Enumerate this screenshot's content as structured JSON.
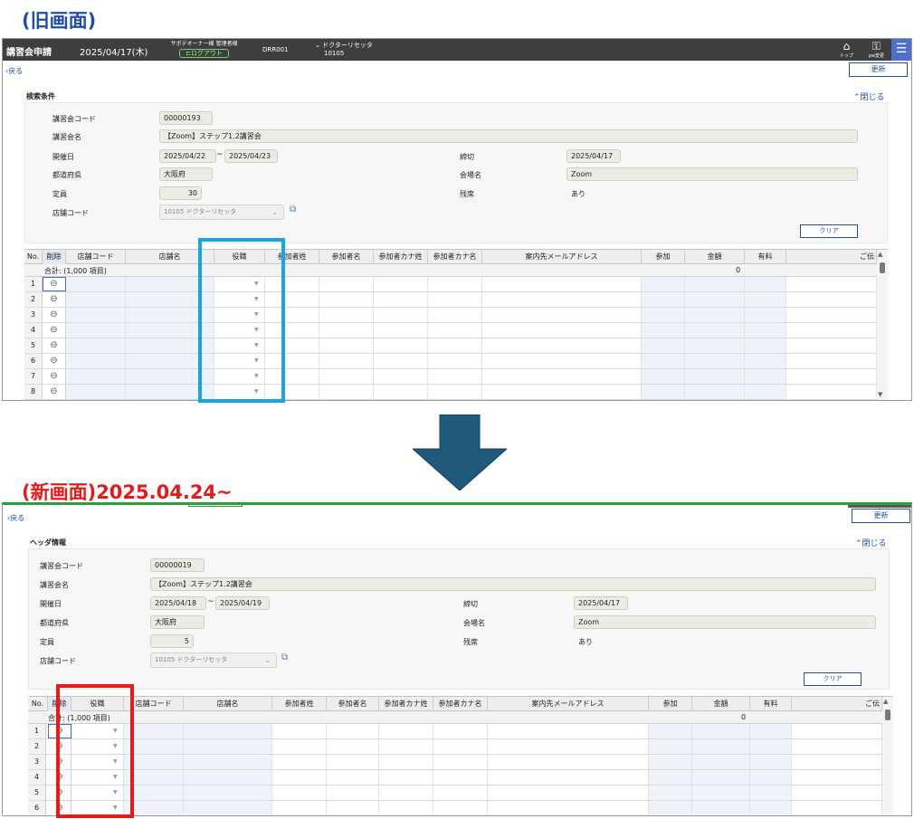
{
  "captions": {
    "old": "(旧画面)",
    "new": "(新画面)2025.04.24~"
  },
  "colors": {
    "highlight_old": "#16a4ea",
    "highlight_new": "#e51a1a",
    "arrow": "#1f5a7a",
    "caption_old": "#1f4fa8",
    "caption_new": "#e51a1a"
  },
  "old": {
    "topbar": {
      "title": "講習会申請",
      "date": "2025/04/17(木)",
      "user_line": "サポデオーナー様 管理者様",
      "logout": "ログアウト",
      "code": "DRR001",
      "store_name": "ドクターリセッタ",
      "store_code": "10105",
      "top_label": "トップ",
      "pw_label": "pw変更",
      "menu_icon": "hamburger-icon"
    },
    "back": "戻る",
    "update": "更新",
    "section_title": "検索条件",
    "close": "閉じる",
    "form": {
      "code_label": "講習会コード",
      "code": "00000193",
      "name_label": "講習会名",
      "name": "【Zoom】ステップ1.2講習会",
      "date_label": "開催日",
      "date_from": "2025/04/22",
      "tilde": "~",
      "date_to": "2025/04/23",
      "deadline_label": "締切",
      "deadline": "2025/04/17",
      "pref_label": "都道府県",
      "pref": "大阪府",
      "venue_label": "会場名",
      "venue": "Zoom",
      "capacity_label": "定員",
      "capacity": "30",
      "remaining_label": "残席",
      "remaining": "あり",
      "store_label": "店舗コード",
      "store": "10105 ドクターリセッタ"
    },
    "clear": "クリア",
    "grid": {
      "headers": [
        "No.",
        "削除",
        "店舗コード",
        "店舗名",
        "役職",
        "参加者姓",
        "参加者名",
        "参加者カナ姓",
        "参加者カナ名",
        "案内先メールアドレス",
        "参加",
        "金額",
        "有料",
        "ご伝"
      ],
      "summary": "合計: (1,000 項目)",
      "summary_value": "0",
      "rows": [
        "1",
        "2",
        "3",
        "4",
        "5",
        "6",
        "7",
        "8"
      ]
    }
  },
  "new": {
    "back": "戻る",
    "update": "更新",
    "section_title": "ヘッダ情報",
    "close": "閉じる",
    "form": {
      "code_label": "講習会コード",
      "code": "00000019",
      "name_label": "講習会名",
      "name": "【Zoom】ステップ1.2講習会",
      "date_label": "開催日",
      "date_from": "2025/04/18",
      "tilde": "~",
      "date_to": "2025/04/19",
      "deadline_label": "締切",
      "deadline": "2025/04/17",
      "pref_label": "都道府県",
      "pref": "大阪府",
      "venue_label": "会場名",
      "venue": "Zoom",
      "capacity_label": "定員",
      "capacity": "5",
      "remaining_label": "残席",
      "remaining": "あり",
      "store_label": "店舗コード",
      "store": "10105 ドクターリセッタ"
    },
    "clear": "クリア",
    "grid": {
      "headers": [
        "No.",
        "削除",
        "役職",
        "店舗コード",
        "店舗名",
        "参加者姓",
        "参加者名",
        "参加者カナ姓",
        "参加者カナ名",
        "案内先メールアドレス",
        "参加",
        "金額",
        "有料",
        "ご伝"
      ],
      "summary": "合計: (1,000 項目)",
      "summary_value": "0",
      "rows": [
        "1",
        "2",
        "3",
        "4",
        "5",
        "6"
      ]
    }
  }
}
